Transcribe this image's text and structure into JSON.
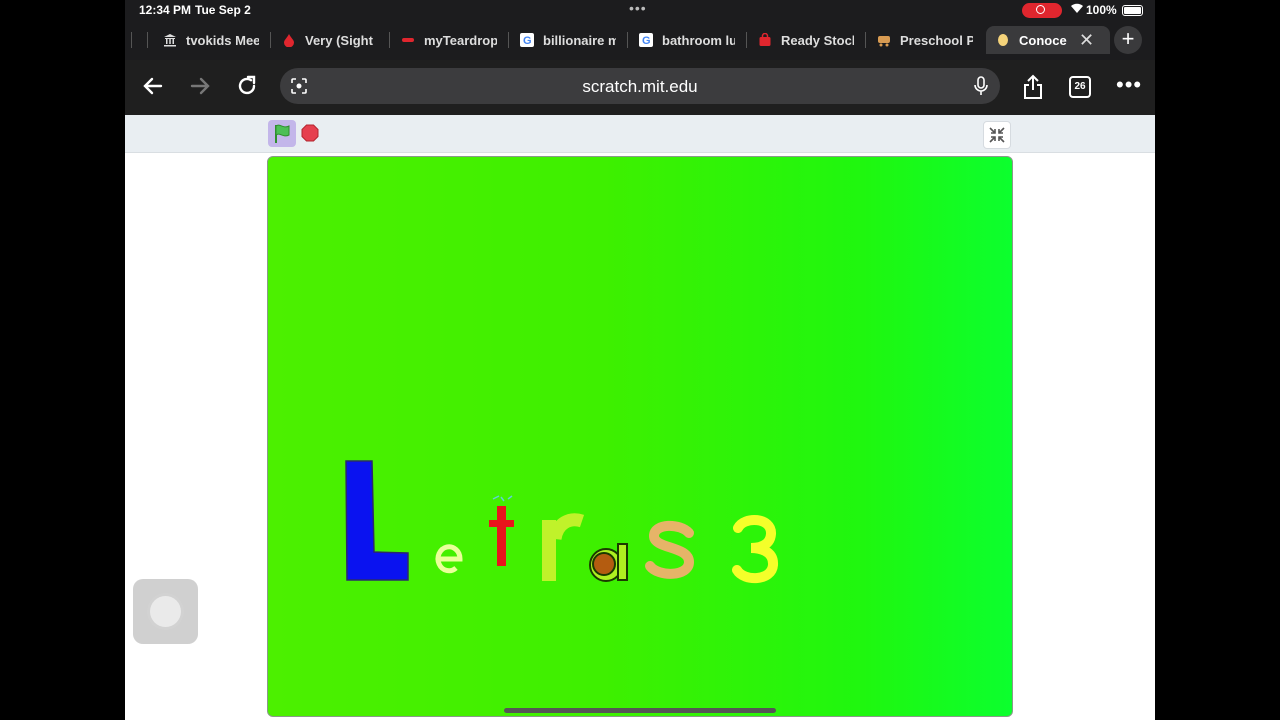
{
  "status": {
    "time": "12:34 PM",
    "date": "Tue Sep 2",
    "battery": "100%"
  },
  "tabs": [
    {
      "label": "tvokids Mee",
      "icon": "bank-icon",
      "color": "#dddddd"
    },
    {
      "label": "Very (Sight",
      "icon": "drop-icon",
      "color": "#e0262e"
    },
    {
      "label": "myTeardrop",
      "icon": "teardrop-icon",
      "color": "#e0262e"
    },
    {
      "label": "billionaire m",
      "icon": "google-icon",
      "color": "#ffffff"
    },
    {
      "label": "bathroom lu",
      "icon": "google-icon",
      "color": "#ffffff"
    },
    {
      "label": "Ready Stock",
      "icon": "bag-icon",
      "color": "#e0262e"
    },
    {
      "label": "Preschool P",
      "icon": "cart-icon",
      "color": "#d89b52"
    },
    {
      "label": "Conoce l",
      "icon": "scratch-icon",
      "color": "#f5d37a",
      "active": true
    }
  ],
  "toolbar": {
    "url": "scratch.mit.edu",
    "tab_count": "26"
  },
  "stage": {
    "letters": [
      "L",
      "e",
      "t",
      "r",
      "a",
      "s",
      "3"
    ],
    "colors": {
      "L": "#0a12f0",
      "e": "#eaff9a",
      "t": "#e8141c",
      "r": "#c0f22a",
      "a": "#aef020",
      "s": "#e6b468",
      "3": "#f4ff2a"
    }
  }
}
